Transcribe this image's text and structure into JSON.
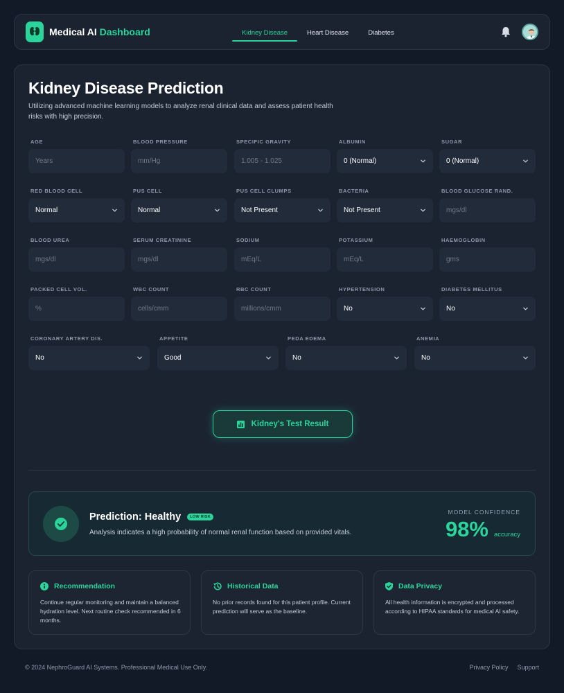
{
  "header": {
    "brand_main": "Medical AI",
    "brand_accent": "Dashboard",
    "logo_icon": "kidney-icon",
    "tabs": [
      {
        "label": "Kidney Disease",
        "active": true
      },
      {
        "label": "Heart Disease",
        "active": false
      },
      {
        "label": "Diabetes",
        "active": false
      }
    ],
    "notification_icon": "bell-icon",
    "avatar_icon": "doctor-avatar"
  },
  "page": {
    "title": "Kidney Disease Prediction",
    "subtitle": "Utilizing advanced machine learning models to analyze renal clinical data and assess patient health risks with high precision."
  },
  "form": {
    "rows": [
      [
        {
          "label": "AGE",
          "type": "input",
          "placeholder": "Years"
        },
        {
          "label": "BLOOD PRESSURE",
          "type": "input",
          "placeholder": "mm/Hg"
        },
        {
          "label": "SPECIFIC GRAVITY",
          "type": "input",
          "placeholder": "1.005 - 1.025"
        },
        {
          "label": "ALBUMIN",
          "type": "select",
          "value": "0 (Normal)"
        },
        {
          "label": "SUGAR",
          "type": "select",
          "value": "0 (Normal)"
        }
      ],
      [
        {
          "label": "RED BLOOD CELL",
          "type": "select",
          "value": "Normal"
        },
        {
          "label": "PUS CELL",
          "type": "select",
          "value": "Normal"
        },
        {
          "label": "PUS CELL CLUMPS",
          "type": "select",
          "value": "Not Present"
        },
        {
          "label": "BACTERIA",
          "type": "select",
          "value": "Not Present"
        },
        {
          "label": "BLOOD GLUCOSE RAND.",
          "type": "input",
          "placeholder": "mgs/dl"
        }
      ],
      [
        {
          "label": "BLOOD UREA",
          "type": "input",
          "placeholder": "mgs/dl"
        },
        {
          "label": "SERUM CREATININE",
          "type": "input",
          "placeholder": "mgs/dl"
        },
        {
          "label": "SODIUM",
          "type": "input",
          "placeholder": "mEq/L"
        },
        {
          "label": "POTASSIUM",
          "type": "input",
          "placeholder": "mEq/L"
        },
        {
          "label": "HAEMOGLOBIN",
          "type": "input",
          "placeholder": "gms"
        }
      ],
      [
        {
          "label": "PACKED CELL VOL.",
          "type": "input",
          "placeholder": "%"
        },
        {
          "label": "WBC COUNT",
          "type": "input",
          "placeholder": "cells/cmm"
        },
        {
          "label": "RBC COUNT",
          "type": "input",
          "placeholder": "millions/cmm"
        },
        {
          "label": "HYPERTENSION",
          "type": "select",
          "value": "No"
        },
        {
          "label": "DIABETES MELLITUS",
          "type": "select",
          "value": "No"
        }
      ],
      [
        {
          "label": "CORONARY ARTERY DIS.",
          "type": "select",
          "value": "No"
        },
        {
          "label": "APPETITE",
          "type": "select",
          "value": "Good"
        },
        {
          "label": "PEDA EDEMA",
          "type": "select",
          "value": "No"
        },
        {
          "label": "ANEMIA",
          "type": "select",
          "value": "No"
        }
      ]
    ],
    "submit_label": "Kidney's Test Result",
    "submit_icon": "bar-chart-icon"
  },
  "prediction": {
    "title": "Prediction: Healthy",
    "badge": "LOW RISK",
    "description": "Analysis indicates a high probability of normal renal function based on provided vitals.",
    "confidence_label": "MODEL CONFIDENCE",
    "confidence_value": "98%",
    "confidence_unit": "accuracy",
    "status_icon": "check-circle-icon"
  },
  "info_cards": [
    {
      "title": "Recommendation",
      "icon": "info-icon",
      "text": "Continue regular monitoring and maintain a balanced hydration level. Next routine check recommended in 6 months."
    },
    {
      "title": "Historical Data",
      "icon": "history-icon",
      "text": "No prior records found for this patient profile. Current prediction will serve as the baseline."
    },
    {
      "title": "Data Privacy",
      "icon": "shield-icon",
      "text": "All health information is encrypted and processed according to HIPAA standards for medical AI safety."
    }
  ],
  "footer": {
    "copyright": "© 2024 NephroGuard AI Systems. Professional Medical Use Only.",
    "links": [
      "Privacy Policy",
      "Support"
    ]
  },
  "colors": {
    "accent": "#2bd49a",
    "background": "#131a27",
    "card": "#1b2331",
    "field": "#222b3a"
  }
}
